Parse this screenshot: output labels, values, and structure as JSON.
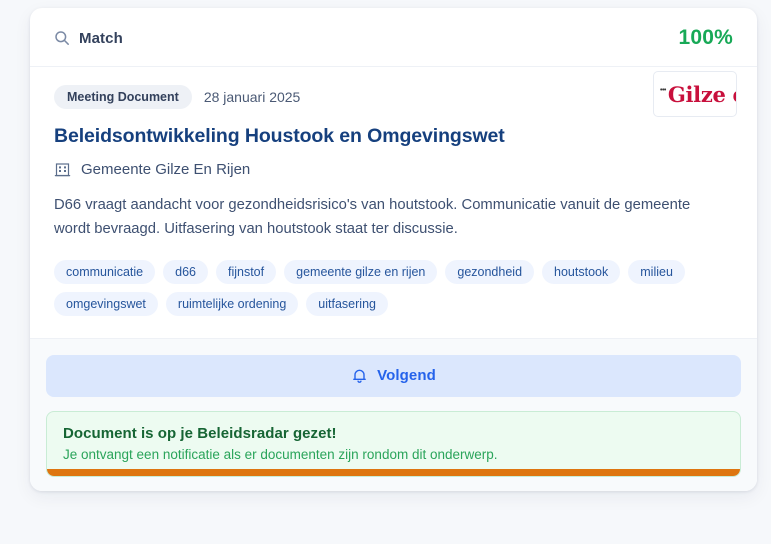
{
  "header": {
    "match_label": "Match",
    "search_icon": "search-icon",
    "match_score": "100%",
    "score_color": "#18a957"
  },
  "document": {
    "type_badge": "Meeting Document",
    "date": "28 januari 2025",
    "title": "Beleidsontwikkeling Houstook en Omgevingswet",
    "organization": "Gemeente Gilze En Rijen",
    "organization_icon": "building-icon",
    "summary": "D66 vraagt aandacht voor gezondheidsrisico's van houtstook. Communicatie vanuit de gemeente wordt bevraagd. Uitfasering van houtstook staat ter discussie.",
    "logo": {
      "mark": "•••",
      "word": "Gilze en Rij",
      "color": "#c8103c"
    },
    "tags": [
      "communicatie",
      "d66",
      "fijnstof",
      "gemeente gilze en rijen",
      "gezondheid",
      "houtstook",
      "milieu",
      "omgevingswet",
      "ruimtelijke ordening",
      "uitfasering"
    ]
  },
  "footer": {
    "follow_button_label": "Volgend",
    "follow_button_icon": "bell-icon",
    "follow_button_color": "#2563eb",
    "success": {
      "title": "Document is op je Beleidsradar gezet!",
      "subtitle": "Je ontvangt een notificatie als er documenten zijn rondom dit onderwerp.",
      "title_color": "#166534",
      "subtitle_color": "#2aa45a",
      "progress_color": "#de7510"
    }
  }
}
